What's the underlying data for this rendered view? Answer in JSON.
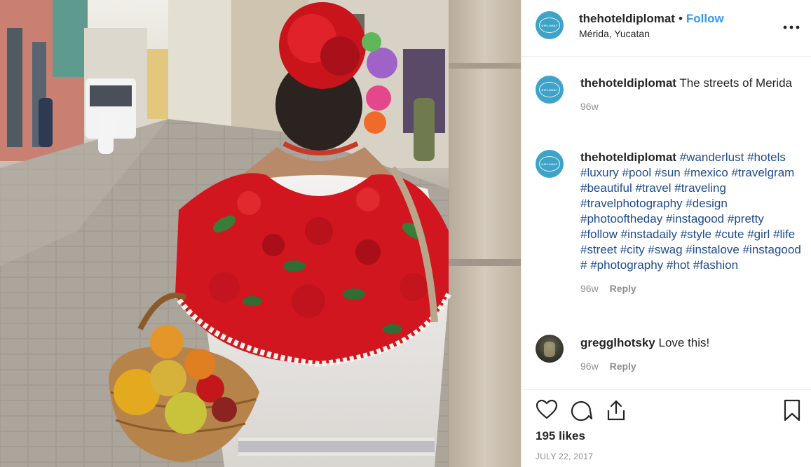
{
  "post": {
    "photo_alt": "Woman in embroidered huipil carrying fruit basket on the streets of Merida",
    "photo_scene": {
      "flower": "red flower headpiece",
      "basket": "fruit basket"
    }
  },
  "header": {
    "username": "thehoteldiplomat",
    "separator": "•",
    "follow_label": "Follow",
    "location": "Mérida, Yucatan",
    "more_icon": "more-options-icon",
    "avatar_text": "DIPLOMAT"
  },
  "comments": [
    {
      "username": "thehoteldiplomat",
      "text": "The streets of Merida",
      "time": "96w",
      "reply": ""
    },
    {
      "username": "thehoteldiplomat",
      "tags": [
        "#wanderlust",
        "#hotels",
        "#luxury",
        "#pool",
        "#sun",
        "#mexico",
        "#travelgram",
        "#beautiful",
        "#travel",
        "#traveling",
        "#travelphotography",
        "#design",
        "#photooftheday",
        "#instagood",
        "#pretty",
        "#follow",
        "#instadaily",
        "#style",
        "#cute",
        "#girl",
        "#life",
        "#street",
        "#city",
        "#swag",
        "#instalove",
        "#instagood",
        "#",
        "#photography",
        "#hot",
        "#fashion"
      ],
      "time": "96w",
      "reply": "Reply"
    },
    {
      "username": "gregglhotsky",
      "text": "Love this!",
      "time": "96w",
      "reply": "Reply"
    }
  ],
  "actions": {
    "like_icon": "heart-icon",
    "comment_icon": "comment-icon",
    "share_icon": "share-icon",
    "save_icon": "bookmark-icon"
  },
  "likes": "195 likes",
  "date": "JULY 22, 2017",
  "colors": {
    "accent": "#3897f0",
    "hashtag": "#1f4b8e",
    "muted": "#8e8e8e",
    "avatar_bg": "#3ea3c8"
  }
}
